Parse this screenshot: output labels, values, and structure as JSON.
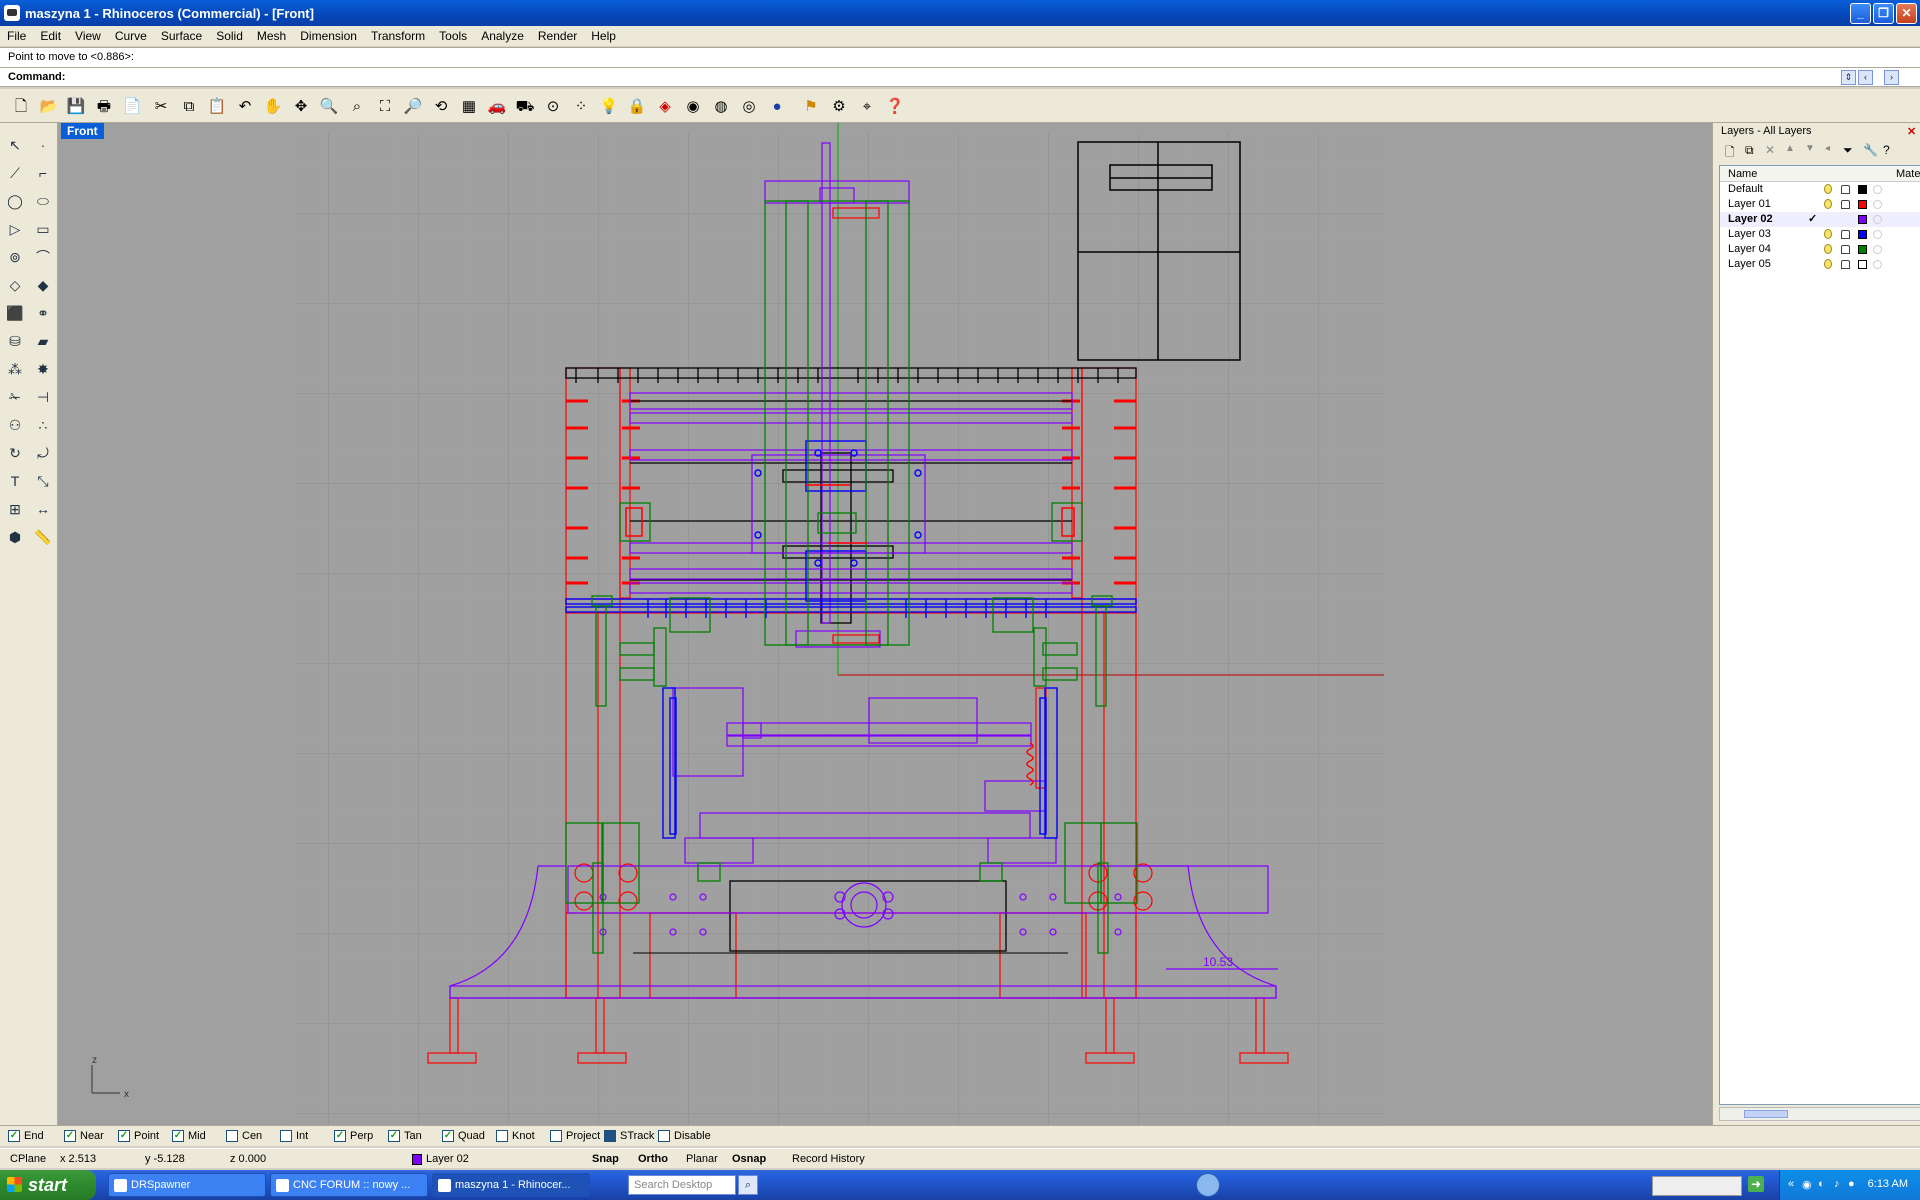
{
  "window": {
    "title": "maszyna 1 - Rhinoceros (Commercial) - [Front]"
  },
  "menu": [
    "File",
    "Edit",
    "View",
    "Curve",
    "Surface",
    "Solid",
    "Mesh",
    "Dimension",
    "Transform",
    "Tools",
    "Analyze",
    "Render",
    "Help"
  ],
  "command": {
    "history": "Point to move to <0.886>:",
    "label": "Command:"
  },
  "viewport": {
    "name": "Front",
    "dimension_value": "10.53",
    "axis_z": "z",
    "axis_x": "x"
  },
  "layers": {
    "title": "Layers - All Layers",
    "col_name": "Name",
    "col_mat": "Mate",
    "rows": [
      {
        "name": "Default",
        "color": "#000000",
        "current": ""
      },
      {
        "name": "Layer 01",
        "color": "#ff0000",
        "current": ""
      },
      {
        "name": "Layer 02",
        "color": "#8000ff",
        "current": "✓"
      },
      {
        "name": "Layer 03",
        "color": "#0000ff",
        "current": ""
      },
      {
        "name": "Layer 04",
        "color": "#008000",
        "current": ""
      },
      {
        "name": "Layer 05",
        "color": "#ffffff",
        "current": ""
      }
    ]
  },
  "osnap": [
    {
      "label": "End",
      "checked": true
    },
    {
      "label": "Near",
      "checked": true
    },
    {
      "label": "Point",
      "checked": true
    },
    {
      "label": "Mid",
      "checked": true
    },
    {
      "label": "Cen",
      "checked": false
    },
    {
      "label": "Int",
      "checked": false
    },
    {
      "label": "Perp",
      "checked": true
    },
    {
      "label": "Tan",
      "checked": true
    },
    {
      "label": "Quad",
      "checked": true
    },
    {
      "label": "Knot",
      "checked": false
    },
    {
      "label": "Project",
      "checked": false
    },
    {
      "label": "STrack",
      "checked": true
    },
    {
      "label": "Disable",
      "checked": false
    }
  ],
  "status": {
    "cplane": "CPlane",
    "x": "x 2.513",
    "y": "y -5.128",
    "z": "z 0.000",
    "layer": "Layer 02",
    "layer_color": "#8000ff",
    "snap": "Snap",
    "ortho": "Ortho",
    "planar": "Planar",
    "osnap": "Osnap",
    "record": "Record History"
  },
  "taskbar": {
    "start": "start",
    "tasks": [
      "DRSpawner",
      "CNC FORUM :: nowy ...",
      "maszyna 1 - Rhinocer..."
    ],
    "search_placeholder": "Search Desktop",
    "clock": "6:13 AM"
  }
}
